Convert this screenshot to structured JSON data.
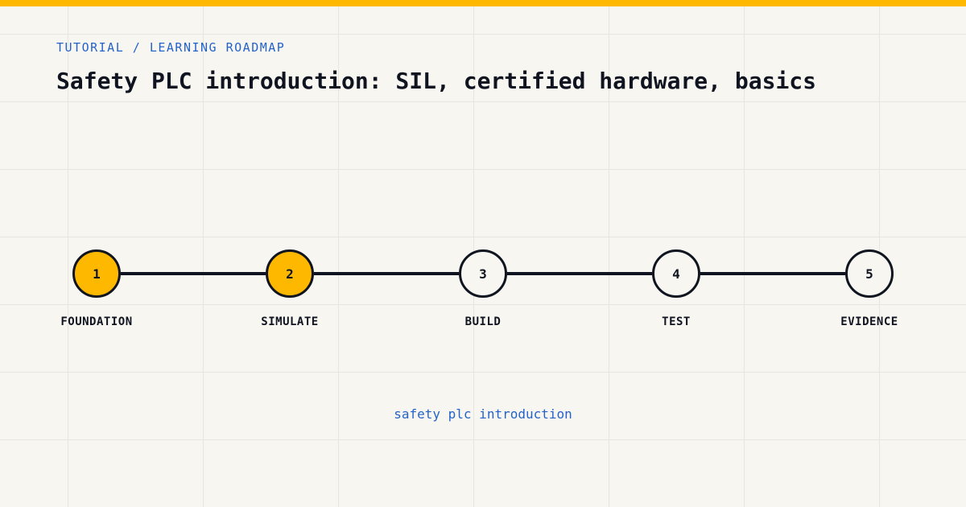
{
  "header": {
    "eyebrow": "TUTORIAL / LEARNING ROADMAP",
    "title": "Safety PLC introduction: SIL, certified hardware, basics"
  },
  "roadmap": {
    "steps": [
      {
        "number": "1",
        "label": "FOUNDATION",
        "completed": true
      },
      {
        "number": "2",
        "label": "SIMULATE",
        "completed": true
      },
      {
        "number": "3",
        "label": "BUILD",
        "completed": false
      },
      {
        "number": "4",
        "label": "TEST",
        "completed": false
      },
      {
        "number": "5",
        "label": "EVIDENCE",
        "completed": false
      }
    ]
  },
  "footer": {
    "caption": "safety plc introduction"
  },
  "colors": {
    "accent": "#ffb800",
    "ink": "#0f1420",
    "link": "#2563c9",
    "background": "#f7f6f1"
  }
}
